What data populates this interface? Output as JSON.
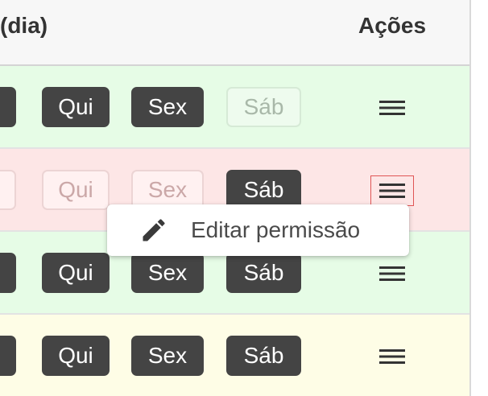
{
  "header": {
    "left_title": "(dia)",
    "actions_title": "Ações"
  },
  "rows": [
    {
      "status": "enabled",
      "days": [
        {
          "label": "",
          "active": true
        },
        {
          "label": "Qui",
          "active": true
        },
        {
          "label": "Sex",
          "active": true
        },
        {
          "label": "Sáb",
          "active": false
        }
      ]
    },
    {
      "status": "disabled",
      "days": [
        {
          "label": "",
          "active": false
        },
        {
          "label": "Qui",
          "active": false
        },
        {
          "label": "Sex",
          "active": false
        },
        {
          "label": "Sáb",
          "active": true
        }
      ]
    },
    {
      "status": "enabled",
      "days": [
        {
          "label": "",
          "active": true
        },
        {
          "label": "Qui",
          "active": true
        },
        {
          "label": "Sex",
          "active": true
        },
        {
          "label": "Sáb",
          "active": true
        }
      ]
    },
    {
      "status": "pending",
      "days": [
        {
          "label": "",
          "active": true
        },
        {
          "label": "Qui",
          "active": true
        },
        {
          "label": "Sex",
          "active": true
        },
        {
          "label": "Sáb",
          "active": true
        }
      ]
    }
  ],
  "row_actions_icon": "menu-icon",
  "popup": {
    "edit_label": "Editar permissão",
    "edit_icon": "pencil-icon"
  },
  "colors": {
    "enabled_row": "#e6fce6",
    "disabled_row": "#fde6e6",
    "pending_row": "#fefde6",
    "active_chip": "#444444",
    "focus_outline": "#e05555"
  }
}
